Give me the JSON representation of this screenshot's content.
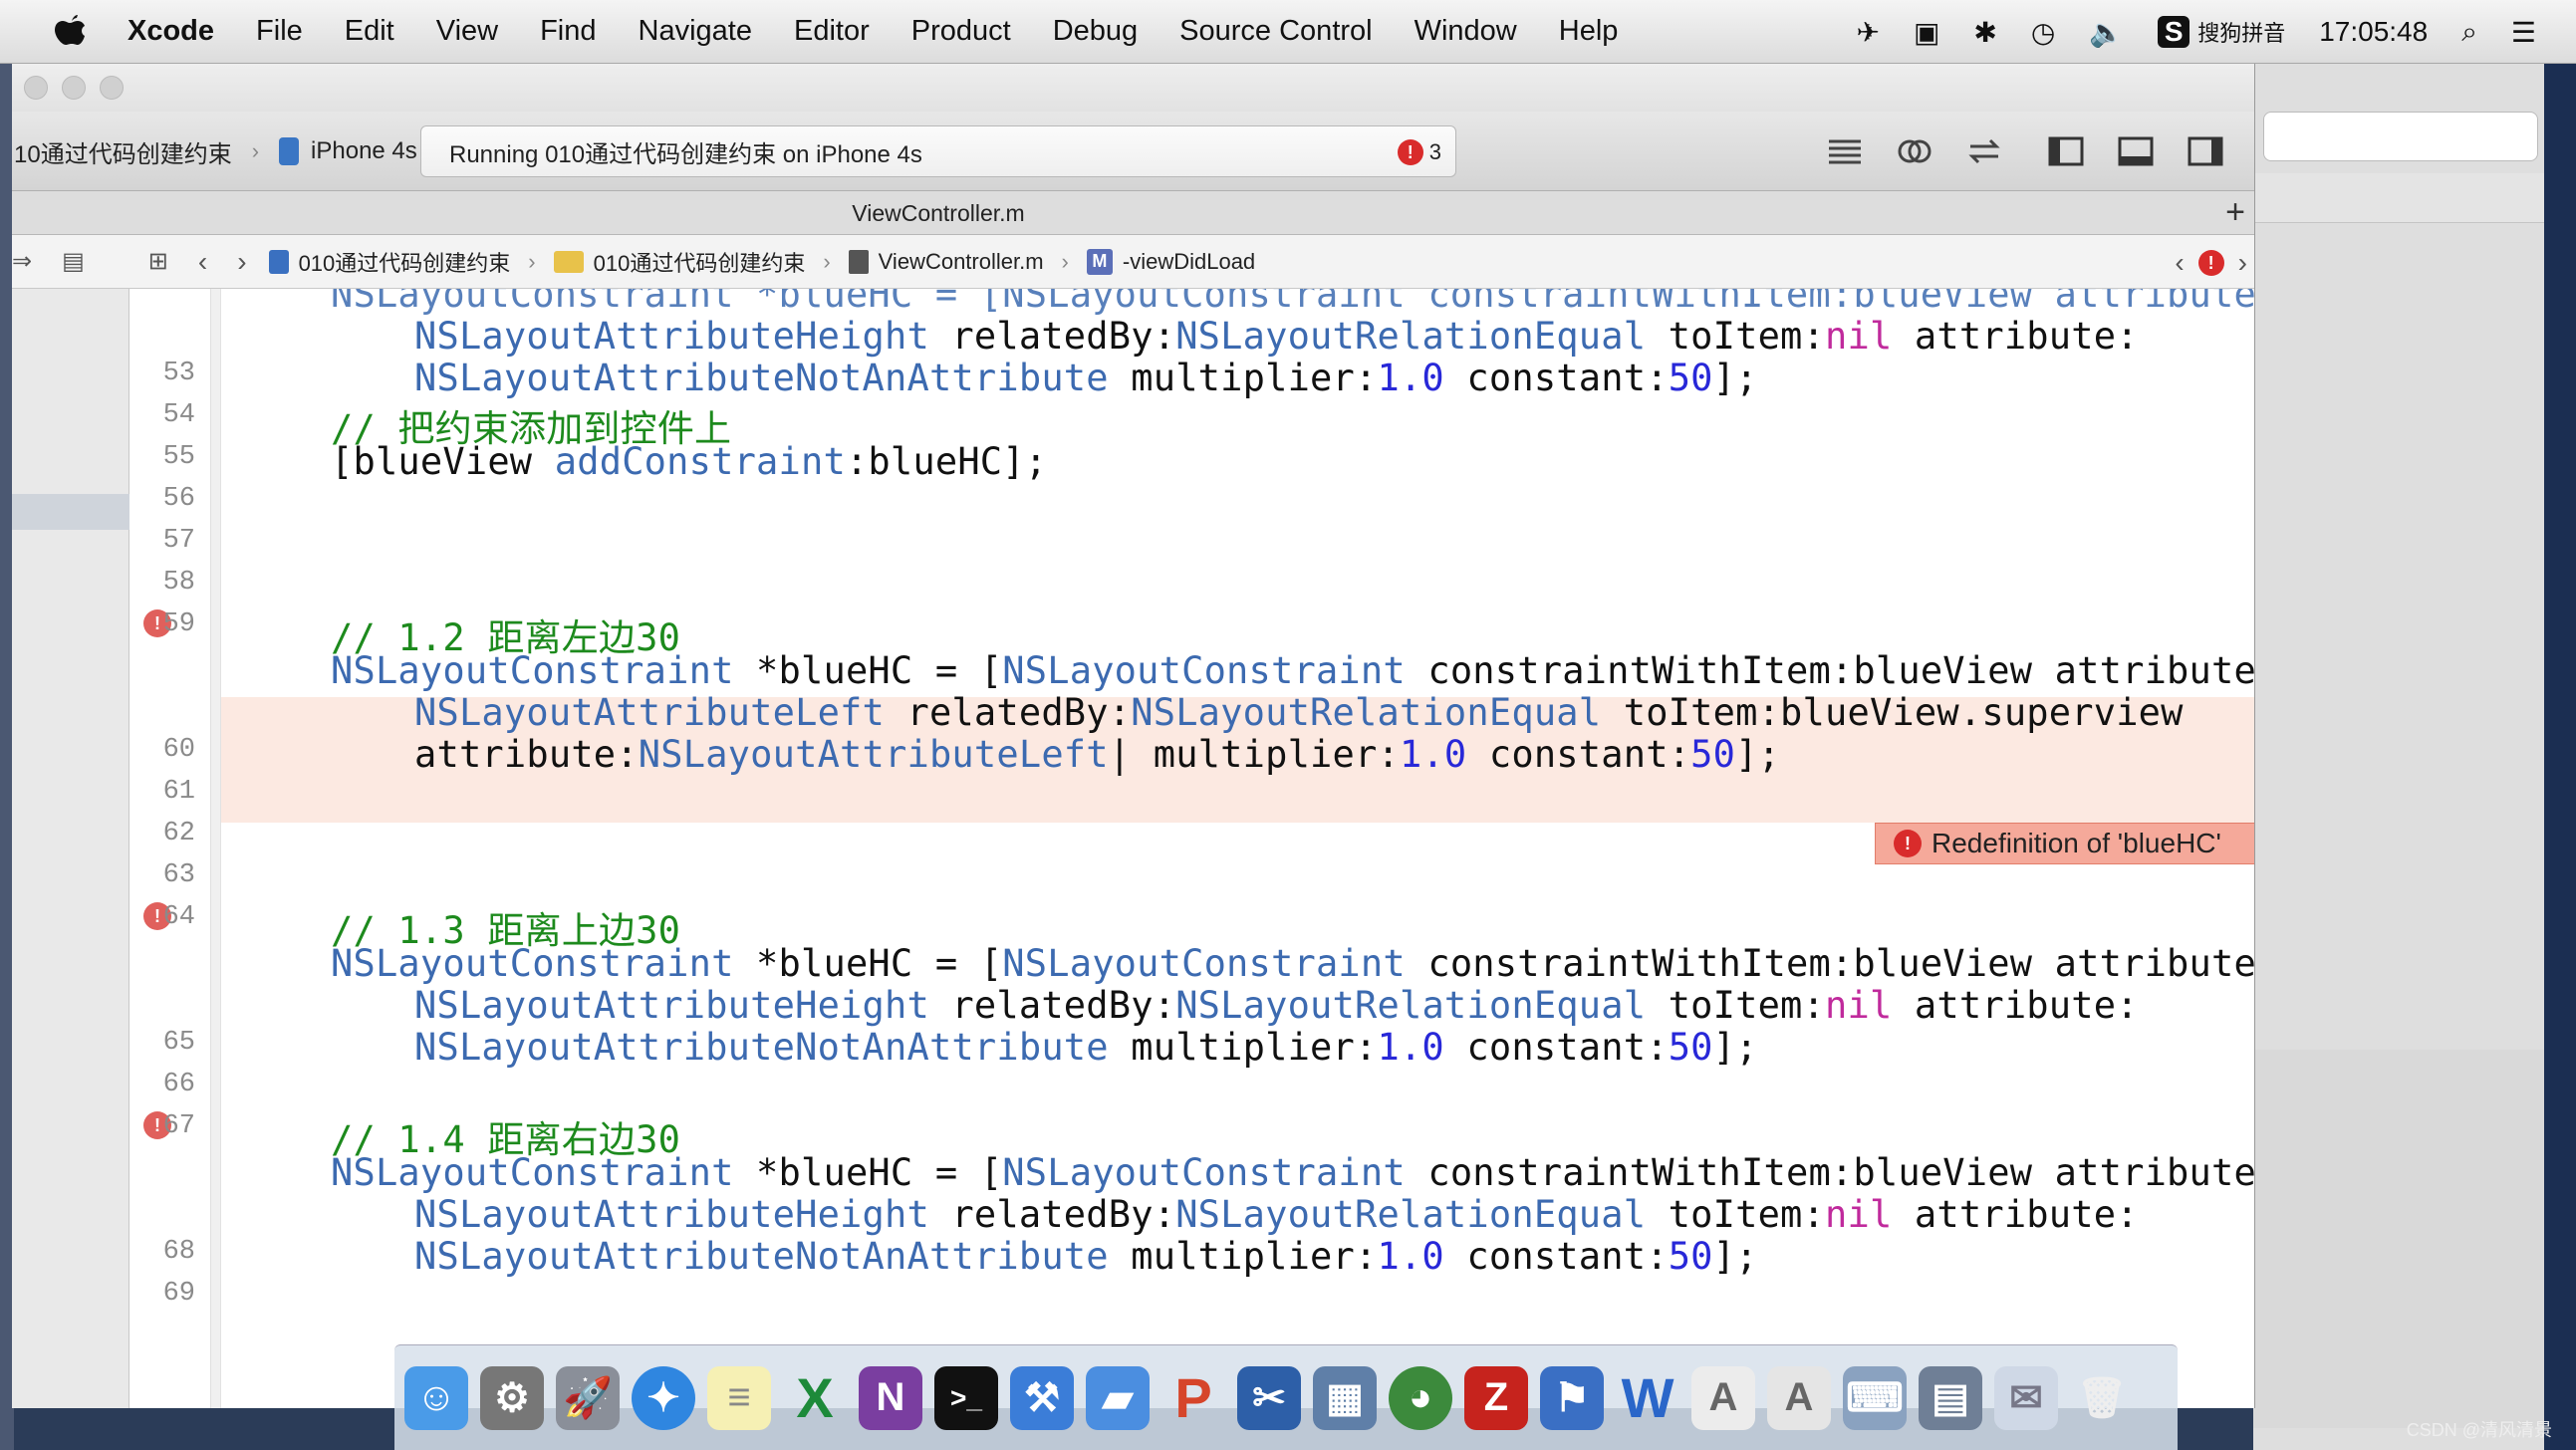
{
  "menubar": {
    "app": "Xcode",
    "items": [
      "File",
      "Edit",
      "View",
      "Find",
      "Navigate",
      "Editor",
      "Product",
      "Debug",
      "Source Control",
      "Window",
      "Help"
    ],
    "input_method": "搜狗拼音",
    "clock": "17:05:48"
  },
  "toolbar": {
    "scheme": "10通过代码创建约束",
    "destination": "iPhone 4s",
    "activity": "Running 010通过代码创建约束 on iPhone 4s",
    "error_count": "3"
  },
  "tab": {
    "title": "ViewController.m"
  },
  "jumpbar": {
    "project": "010通过代码创建约束",
    "group": "010通过代码创建约束",
    "file": "ViewController.m",
    "method": "-viewDidLoad"
  },
  "editor": {
    "line_numbers": {
      "l53": "53",
      "l54": "54",
      "l55": "55",
      "l56": "56",
      "l57": "57",
      "l58": "58",
      "l59": "59",
      "l60": "60",
      "l61": "61",
      "l62": "62",
      "l63": "63",
      "l64": "64",
      "l65": "65",
      "l66": "66",
      "l67": "67",
      "l68": "68",
      "l69": "69"
    },
    "partial_top_line": "NSLayoutConstraint *blueHC = [NSLayoutConstraint constraintWithItem:blueView attribute:",
    "comment_53": "// 把约束添加到控件上",
    "comment_58": "// 1.2 距离左边30",
    "comment_63": "// 1.3 距离上边30",
    "comment_66": "// 1.4 距离右边30",
    "error_message": "Redefinition of 'blueHC'"
  },
  "watermark": "CSDN @清风清景"
}
